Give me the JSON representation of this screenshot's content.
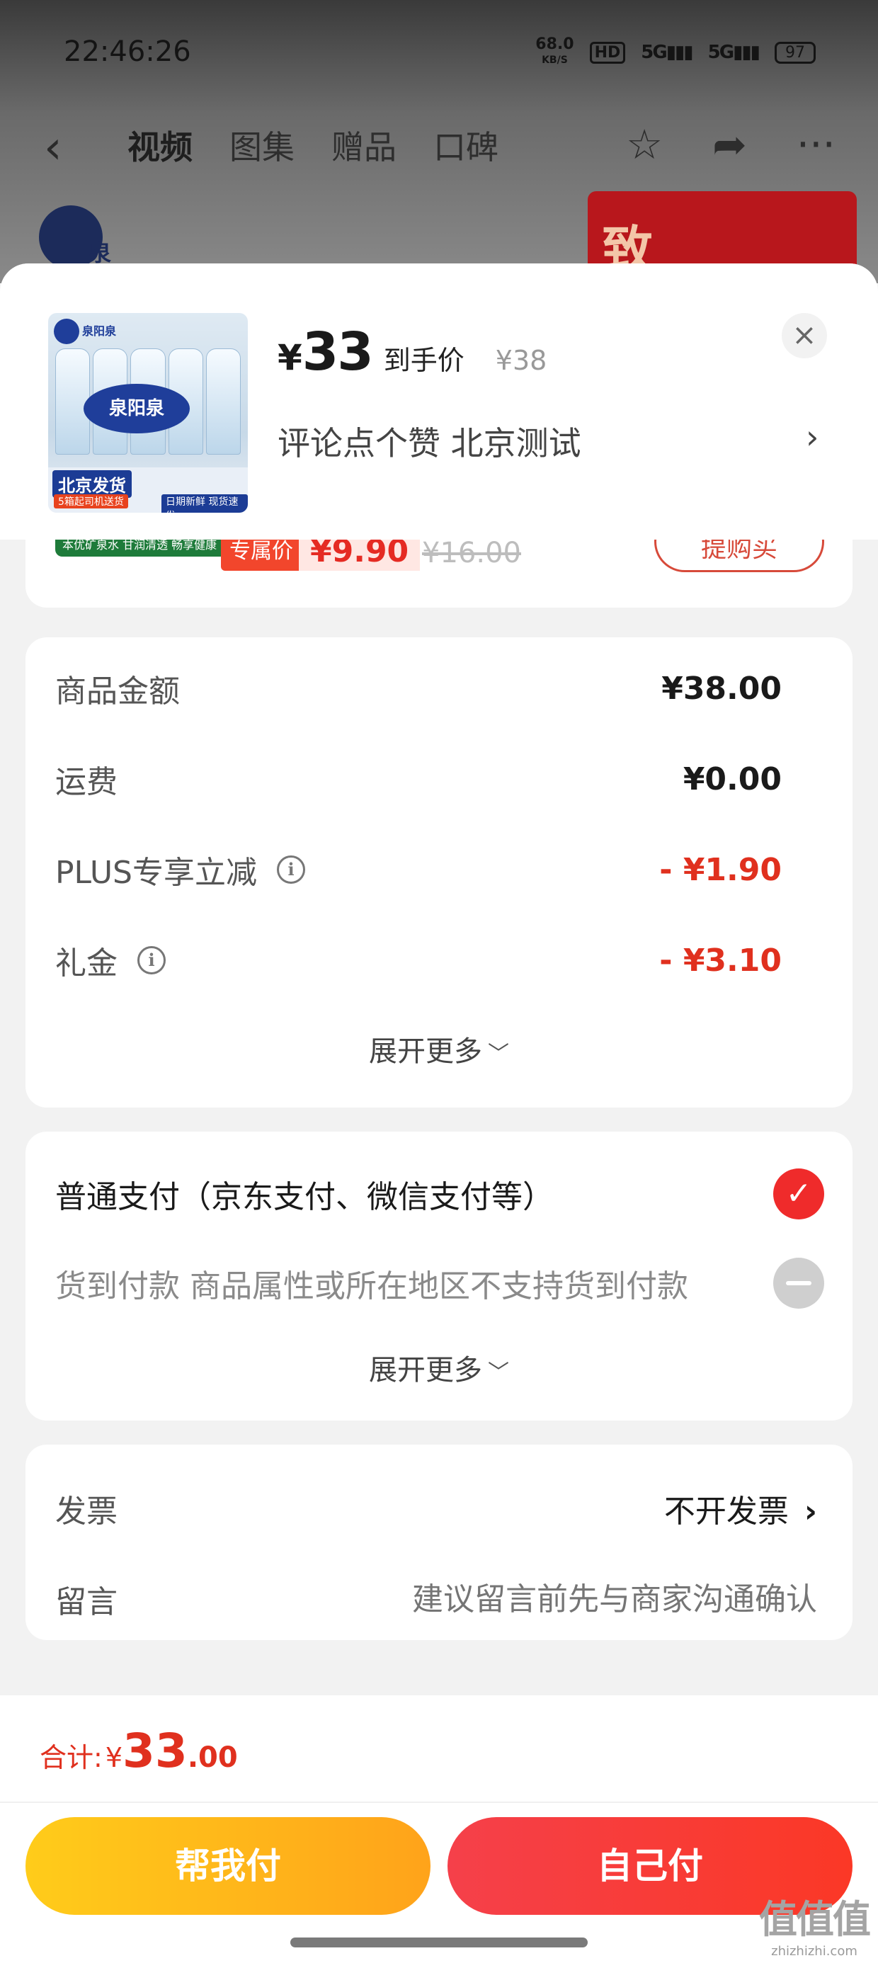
{
  "status_bar": {
    "time": "22:46:26",
    "net_speed": "68.0",
    "net_unit": "KB/S",
    "hd": "HD",
    "signal1": "5G",
    "signal2": "5G",
    "battery": "97"
  },
  "top_nav": {
    "tabs": [
      "视频",
      "图集",
      "赠品",
      "口碑"
    ],
    "active_tab": "视频"
  },
  "background": {
    "logo_text": "泉阳泉",
    "banner_text": "致"
  },
  "product": {
    "thumb_logo": "泉阳泉",
    "thumb_label": "泉阳泉",
    "thumb_badge": "北京发货",
    "thumb_tag1": "5箱起司机送货",
    "thumb_tag2": "日期新鲜 现货速发",
    "price_symbol": "¥",
    "price": "33",
    "price_tag": "到手价",
    "original_price": "¥38",
    "spec": "评论点个赞  北京测试",
    "spec_arrow": "›",
    "close": "×"
  },
  "cutoff": {
    "green_strip": "本优矿泉水 甘润清透 畅享健康",
    "exclusive_label": "专属价",
    "exclusive_price": "¥9.90",
    "exclusive_orig": "¥16.00",
    "buy_button": "提购买"
  },
  "costs": [
    {
      "label": "商品金额",
      "value": "¥38.00",
      "info": false,
      "red": false
    },
    {
      "label": "运费",
      "value": "¥0.00",
      "info": false,
      "red": false
    },
    {
      "label": "PLUS专享立减",
      "value": "- ¥1.90",
      "info": true,
      "red": true
    },
    {
      "label": "礼金",
      "value": "- ¥3.10",
      "info": true,
      "red": true
    }
  ],
  "expand_label": "展开更多",
  "payment": {
    "options": [
      {
        "label": "普通支付（京东支付、微信支付等）",
        "selected": true
      },
      {
        "label": "货到付款 商品属性或所在地区不支持货到付款",
        "selected": false
      }
    ],
    "expand_label": "展开更多"
  },
  "misc": {
    "invoice_label": "发票",
    "invoice_value": "不开发票",
    "message_label": "留言",
    "message_placeholder": "建议留言前先与商家沟通确认"
  },
  "bottom": {
    "total_label": "合计:",
    "total_symbol": "¥",
    "total_int": "33",
    "total_dec": ".00",
    "help_pay": "帮我付",
    "self_pay": "自己付"
  },
  "watermark": {
    "big": "值值值",
    "small": "zhizhizhi.com"
  },
  "colors": {
    "accent_red": "#e0301e",
    "help_button": "#ffb21a",
    "self_button": "#f63a35"
  }
}
